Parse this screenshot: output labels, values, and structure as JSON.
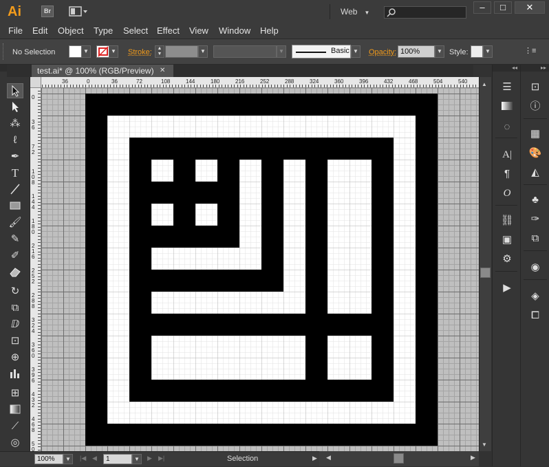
{
  "app": {
    "logo": "Ai",
    "bridge_label": "Br",
    "arrange_icon": "arrange-documents-icon"
  },
  "workspace": {
    "label": "Web"
  },
  "search": {
    "placeholder": ""
  },
  "window_buttons": {
    "minimize": "–",
    "maximize": "□",
    "close": "✕"
  },
  "menu": [
    "File",
    "Edit",
    "Object",
    "Type",
    "Select",
    "Effect",
    "View",
    "Window",
    "Help"
  ],
  "control": {
    "selection_status": "No Selection",
    "stroke_label": "Stroke:",
    "brush_label": "Basic",
    "opacity_label": "Opacity:",
    "opacity_value": "100%",
    "style_label": "Style:"
  },
  "document": {
    "tab_title": "test.ai* @ 100% (RGB/Preview)",
    "close": "✕"
  },
  "ruler": {
    "h_labels": [
      "36",
      "0",
      "36",
      "72",
      "108",
      "144",
      "180",
      "216",
      "252",
      "288",
      "324",
      "360",
      "396",
      "432",
      "468",
      "504",
      "540"
    ],
    "v_labels": [
      "36",
      "0",
      "36",
      "72",
      "108",
      "144",
      "180",
      "216",
      "252",
      "288",
      "324",
      "360",
      "396",
      "432",
      "468",
      "504"
    ]
  },
  "status": {
    "zoom": "100%",
    "page": "1",
    "mode": "Selection"
  },
  "colors": {
    "accent": "#f29b1b",
    "ui_bg": "#323232",
    "canvas": "#bfbfbf",
    "artboard": "#ffffff",
    "art": "#000000"
  },
  "tools": [
    "selection-tool",
    "direct-selection-tool",
    "magic-wand-tool",
    "lasso-tool",
    "pen-tool",
    "type-tool",
    "line-tool",
    "rectangle-tool",
    "paintbrush-tool",
    "pencil-tool",
    "blob-brush-tool",
    "eraser-tool",
    "rotate-tool",
    "scale-tool",
    "warp-tool",
    "free-transform-tool",
    "shape-builder-tool",
    "perspective-grid-tool",
    "mesh-tool",
    "gradient-tool",
    "eyedropper-tool",
    "blend-tool"
  ],
  "panels_right_1": [
    "menu-icon",
    "gradient-icon",
    "transparency-icon",
    "character-icon",
    "paragraph-icon",
    "opentype-icon",
    "links-icon",
    "image-trace-icon",
    "actions-icon",
    "navigator-play-icon"
  ],
  "panels_right_2": [
    "transform-icon",
    "info-icon",
    "swatches-grid-icon",
    "color-palette-icon",
    "color-guide-icon",
    "symbols-icon",
    "brushes-icon",
    "graphic-styles-icon",
    "appearance-icon",
    "layers-icon",
    "artboards-icon"
  ]
}
